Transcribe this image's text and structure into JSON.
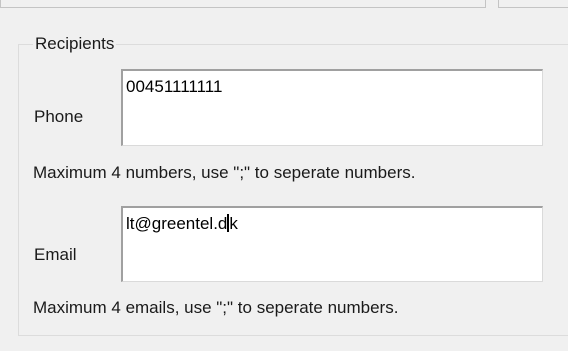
{
  "recipients": {
    "title": "Recipients",
    "phone": {
      "label": "Phone",
      "value": "00451111111",
      "hint": "Maximum 4 numbers, use \";\" to seperate numbers."
    },
    "email": {
      "label": "Email",
      "value_before_caret": "lt@greentel.d",
      "value_after_caret": "k",
      "hint": "Maximum 4 emails, use \";\" to seperate numbers."
    }
  }
}
